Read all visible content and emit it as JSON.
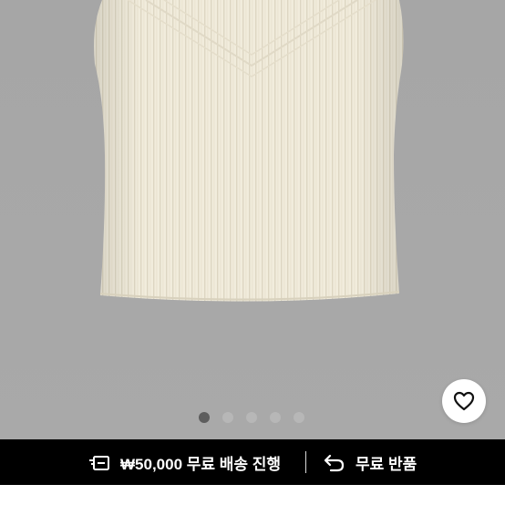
{
  "product": {
    "image_alt": "Cream ribbed knit sleeveless top",
    "image_count": 5,
    "active_image": 1
  },
  "carousel": {
    "dots": [
      "1",
      "2",
      "3",
      "4",
      "5"
    ]
  },
  "favorite": {
    "icon": "heart-icon"
  },
  "shipping_bar": {
    "free_shipping_label": "₩50,000 무료 배송 진행",
    "free_shipping_icon": "delivery-icon",
    "free_return_label": "무료 반품",
    "free_return_icon": "return-arrow-icon"
  },
  "colors": {
    "background": "#a7a7a7",
    "garment": "#f1ecdc",
    "bar": "#000000",
    "dot_active": "#5d5d5d",
    "dot_inactive": "#b7b7b7"
  }
}
